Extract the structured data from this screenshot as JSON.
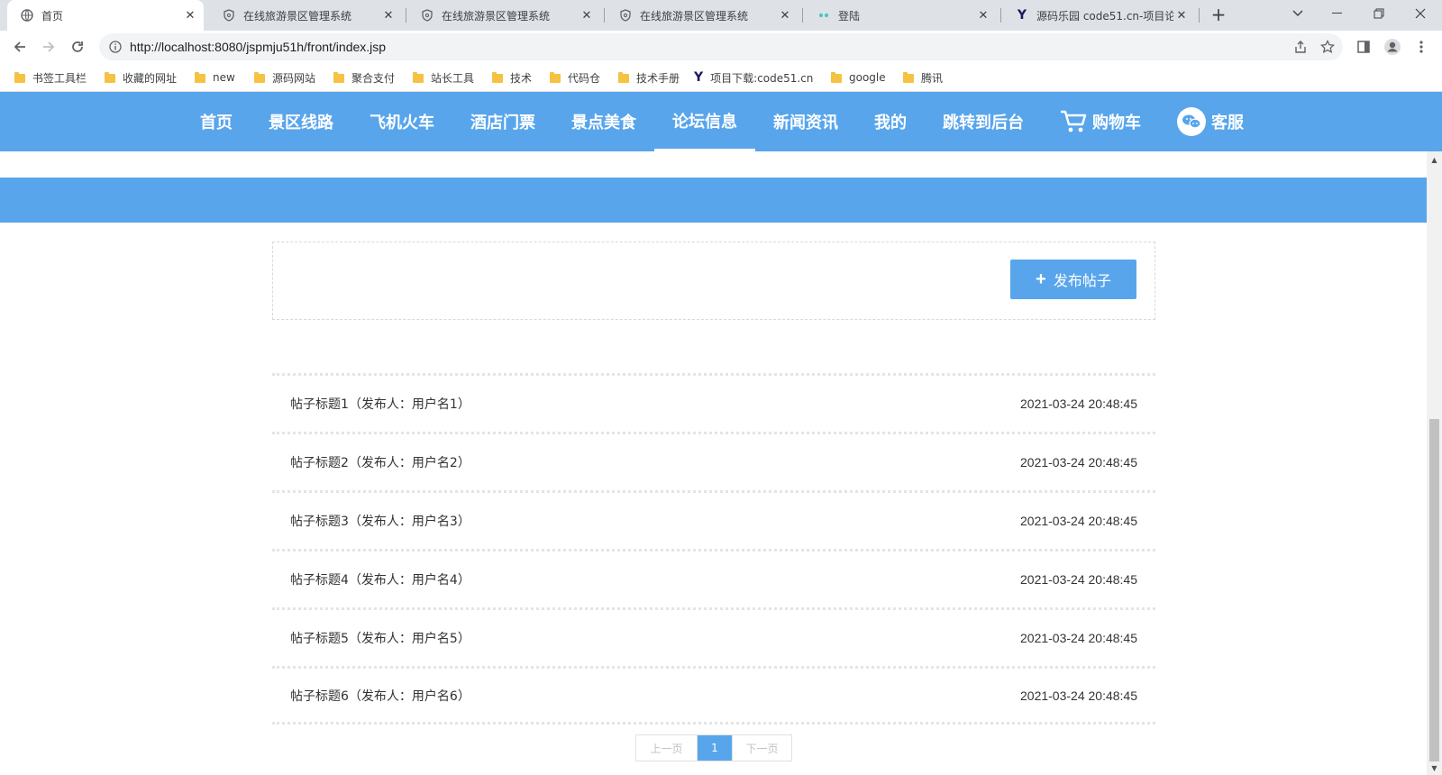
{
  "browser": {
    "tabs": [
      {
        "title": "首页",
        "icon": "globe-icon",
        "active": true
      },
      {
        "title": "在线旅游景区管理系统",
        "icon": "shield-icon",
        "active": false
      },
      {
        "title": "在线旅游景区管理系统",
        "icon": "shield-icon",
        "active": false
      },
      {
        "title": "在线旅游景区管理系统",
        "icon": "shield-icon",
        "active": false
      },
      {
        "title": "登陆",
        "icon": "dots-icon",
        "active": false
      },
      {
        "title": "源码乐园 code51.cn-项目论",
        "icon": "y-logo-icon",
        "active": false
      }
    ],
    "new_tab_label": "+",
    "url": "http://localhost:8080/jspmju51h/front/index.jsp",
    "bookmarks": [
      {
        "label": "书签工具栏",
        "icon": "folder-icon"
      },
      {
        "label": "收藏的网址",
        "icon": "folder-icon"
      },
      {
        "label": "new",
        "icon": "folder-icon"
      },
      {
        "label": "源码网站",
        "icon": "folder-icon"
      },
      {
        "label": "聚合支付",
        "icon": "folder-icon"
      },
      {
        "label": "站长工具",
        "icon": "folder-icon"
      },
      {
        "label": "技术",
        "icon": "folder-icon"
      },
      {
        "label": "代码仓",
        "icon": "folder-icon"
      },
      {
        "label": "技术手册",
        "icon": "folder-icon"
      },
      {
        "label": "项目下载:code51.cn",
        "icon": "y-logo-icon"
      },
      {
        "label": "google",
        "icon": "folder-icon"
      },
      {
        "label": "腾讯",
        "icon": "folder-icon"
      }
    ]
  },
  "site": {
    "accent_color": "#58a5ec",
    "nav": [
      {
        "label": "首页"
      },
      {
        "label": "景区线路"
      },
      {
        "label": "飞机火车"
      },
      {
        "label": "酒店门票"
      },
      {
        "label": "景点美食"
      },
      {
        "label": "论坛信息",
        "active": true
      },
      {
        "label": "新闻资讯"
      },
      {
        "label": "我的"
      },
      {
        "label": "跳转到后台"
      },
      {
        "label": "购物车",
        "icon": "cart-icon"
      },
      {
        "label": "客服",
        "icon": "wechat-icon"
      }
    ]
  },
  "forum": {
    "publish_label": "发布帖子",
    "publish_icon": "plus-icon",
    "posts": [
      {
        "title": "帖子标题1（发布人：用户名1）",
        "date": "2021-03-24 20:48:45"
      },
      {
        "title": "帖子标题2（发布人：用户名2）",
        "date": "2021-03-24 20:48:45"
      },
      {
        "title": "帖子标题3（发布人：用户名3）",
        "date": "2021-03-24 20:48:45"
      },
      {
        "title": "帖子标题4（发布人：用户名4）",
        "date": "2021-03-24 20:48:45"
      },
      {
        "title": "帖子标题5（发布人：用户名5）",
        "date": "2021-03-24 20:48:45"
      },
      {
        "title": "帖子标题6（发布人：用户名6）",
        "date": "2021-03-24 20:48:45"
      }
    ],
    "pager": {
      "prev": "上一页",
      "current": "1",
      "next": "下一页"
    }
  }
}
